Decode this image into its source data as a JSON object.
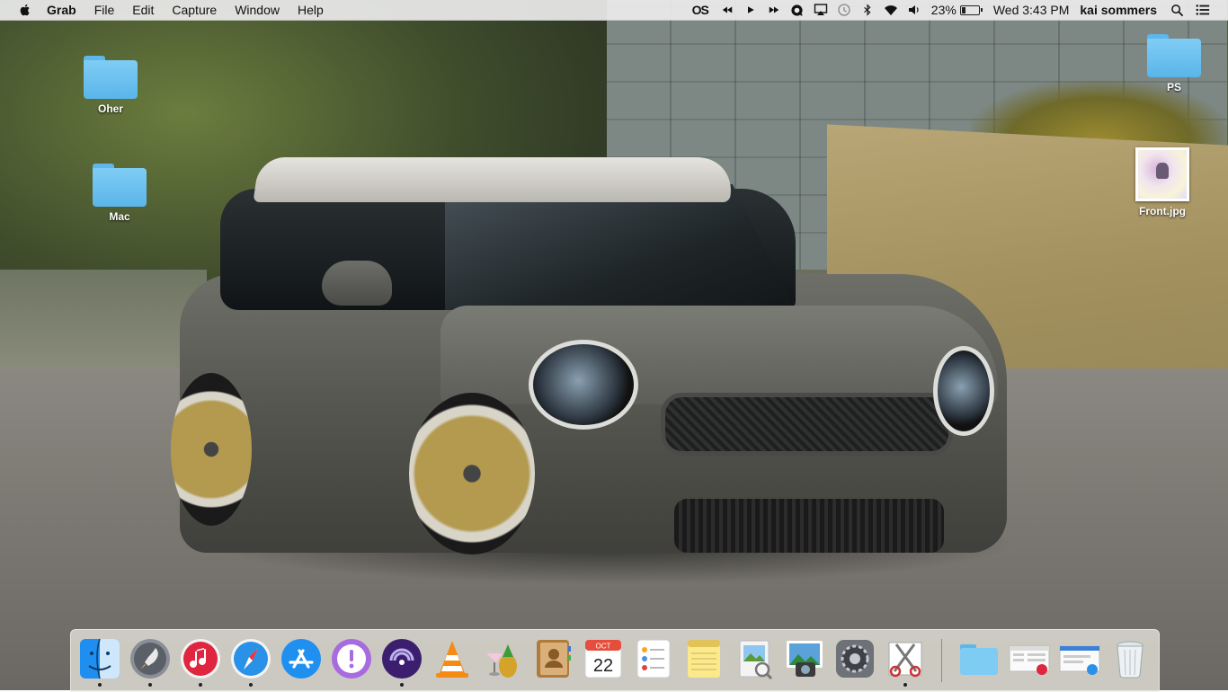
{
  "menubar": {
    "app_name": "Grab",
    "menus": [
      "File",
      "Edit",
      "Capture",
      "Window",
      "Help"
    ],
    "status": {
      "os_badge": "OS",
      "battery_percent": "23%",
      "battery_level": 0.23,
      "clock": "Wed 3:43 PM",
      "user": "kai sommers"
    },
    "icons": [
      "apple-icon",
      "media-prev-icon",
      "media-play-icon",
      "media-next-icon",
      "quicktime-icon",
      "airplay-icon",
      "time-machine-icon",
      "bluetooth-icon",
      "wifi-icon",
      "volume-icon",
      "battery-icon",
      "spotlight-icon",
      "notification-center-icon"
    ]
  },
  "desktop": {
    "items": [
      {
        "label": "Oher",
        "type": "folder"
      },
      {
        "label": "Mac",
        "type": "folder"
      },
      {
        "label": "PS",
        "type": "folder"
      },
      {
        "label": "Front.jpg",
        "type": "image"
      }
    ]
  },
  "dock": {
    "calendar_month": "OCT",
    "calendar_day": "22",
    "apps": [
      {
        "name": "finder-icon",
        "running": true
      },
      {
        "name": "launchpad-icon",
        "running": true
      },
      {
        "name": "itunes-icon",
        "running": true
      },
      {
        "name": "safari-icon",
        "running": true
      },
      {
        "name": "app-store-icon",
        "running": false
      },
      {
        "name": "feedback-icon",
        "running": false
      },
      {
        "name": "bittorrent-icon",
        "running": true
      },
      {
        "name": "vlc-icon",
        "running": false
      },
      {
        "name": "ananas-icon",
        "running": false
      },
      {
        "name": "contacts-icon",
        "running": false
      },
      {
        "name": "calendar-icon",
        "running": false
      },
      {
        "name": "reminders-icon",
        "running": false
      },
      {
        "name": "notes-icon",
        "running": false
      },
      {
        "name": "preview-icon",
        "running": false
      },
      {
        "name": "iphoto-icon",
        "running": false
      },
      {
        "name": "system-preferences-icon",
        "running": false
      },
      {
        "name": "grab-icon",
        "running": true
      }
    ],
    "stack_items": [
      "documents-folder-icon",
      "music-stack-icon",
      "safari-stack-icon",
      "trash-icon"
    ]
  }
}
